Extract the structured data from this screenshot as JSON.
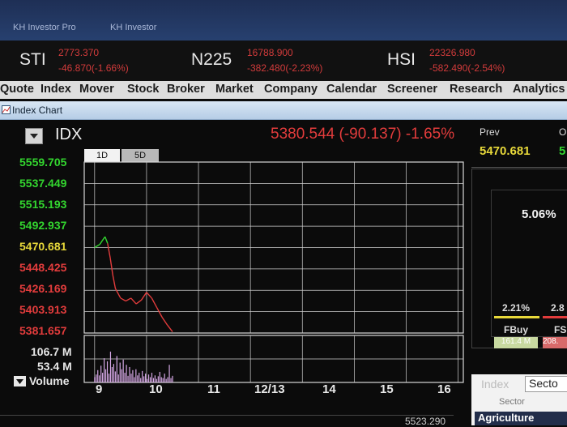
{
  "window": {
    "tabs": [
      "KH Investor Pro",
      "KH Investor"
    ]
  },
  "ticker": [
    {
      "name": "STI",
      "value": "2773.370",
      "change": "-46.870(-1.66%)"
    },
    {
      "name": "N225",
      "value": "16788.900",
      "change": "-382.480(-2.23%)"
    },
    {
      "name": "HSI",
      "value": "22326.980",
      "change": "-582.490(-2.54%)"
    }
  ],
  "menu": [
    "Quote",
    "Index",
    "Mover",
    "Stock",
    "Broker",
    "Market",
    "Company",
    "Calendar",
    "Screener",
    "Research",
    "Analytics"
  ],
  "panel_title": "Index Chart",
  "chart_header": {
    "symbol": "IDX",
    "last": "5380.544 (-90.137) -1.65%"
  },
  "range_buttons": [
    "1D",
    "5D"
  ],
  "colors": {
    "green": "#33d62f",
    "yellow": "#e8d93a",
    "red": "#e23c3c",
    "volume": "#d6a8e6"
  },
  "chart_data": {
    "type": "line",
    "x_ticks": [
      "9",
      "10",
      "11",
      "12/13",
      "14",
      "15",
      "16"
    ],
    "y_ticks": [
      "5559.705",
      "5537.449",
      "5515.193",
      "5492.937",
      "5470.681",
      "5448.425",
      "5426.169",
      "5403.913",
      "5381.657"
    ],
    "ylim": [
      5381.657,
      5559.705
    ],
    "prev_close": 5470.681,
    "x": [
      9.0,
      9.1,
      9.15,
      9.2,
      9.25,
      9.3,
      9.35,
      9.4,
      9.5,
      9.6,
      9.7,
      9.8,
      9.9,
      10.0,
      10.1,
      10.2,
      10.3,
      10.4,
      10.5
    ],
    "y": [
      5470.7,
      5474,
      5478,
      5482,
      5475,
      5460,
      5442,
      5428,
      5418,
      5415,
      5418,
      5412,
      5416,
      5424,
      5418,
      5408,
      5398,
      5390,
      5383
    ],
    "volume_labels": [
      "106.7 M",
      "53.4 M",
      "Volume"
    ],
    "volume_max": 106.7,
    "volume": [
      12,
      18,
      28,
      16,
      38,
      22,
      55,
      30,
      48,
      20,
      70,
      35,
      42,
      25,
      60,
      18,
      45,
      30,
      52,
      22,
      40,
      15,
      35,
      20,
      28,
      12,
      30,
      16,
      22,
      10,
      26,
      14,
      20,
      8,
      18,
      12,
      22,
      10,
      16,
      8,
      14,
      24,
      12,
      10,
      20,
      8,
      12,
      40,
      10,
      15
    ]
  },
  "right_panel": {
    "prev_label": "Prev",
    "prev_value": "5470.681",
    "open_label": "O",
    "pct": "5.06%",
    "fbuy_pct": "2.21%",
    "fbuy_label": "FBuy",
    "fbuy_value": "161.4 M",
    "fsell_pct": "2.8",
    "fsell_label": "FS",
    "fsell_value": "208.",
    "tabs": [
      "Index",
      "Secto"
    ],
    "sector_header": "Sector",
    "sector_row": "Agriculture"
  },
  "bottom_value": "5523.290"
}
